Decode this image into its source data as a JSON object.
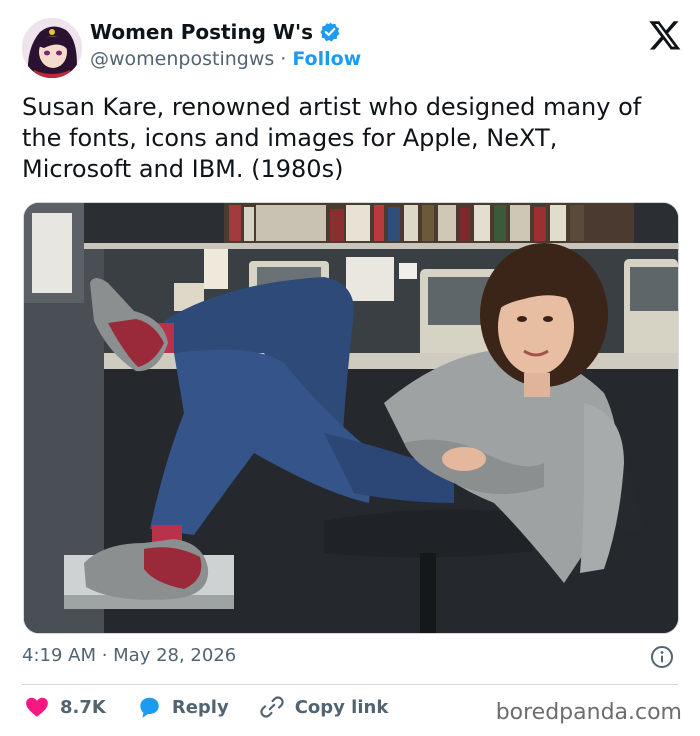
{
  "author": {
    "display_name": "Women Posting W's",
    "handle": "@womenpostingws",
    "separator": "·",
    "follow_label": "Follow"
  },
  "tweet": {
    "text": "Susan Kare, renowned artist who designed many of the fonts, icons and images for Apple, NeXT, Microsoft and IBM. (1980s)",
    "timestamp": "4:19 AM · May 28, 2026"
  },
  "actions": {
    "likes": "8.7K",
    "reply_label": "Reply",
    "copy_link_label": "Copy link"
  },
  "watermark": "boredpanda.com",
  "colors": {
    "accent": "#1d9bf0",
    "like": "#f91880",
    "text": "#0f1419",
    "muted": "#536471"
  },
  "icons": [
    "verified-badge-icon",
    "x-logo-icon",
    "info-icon",
    "heart-icon",
    "reply-bubble-icon",
    "link-icon"
  ]
}
